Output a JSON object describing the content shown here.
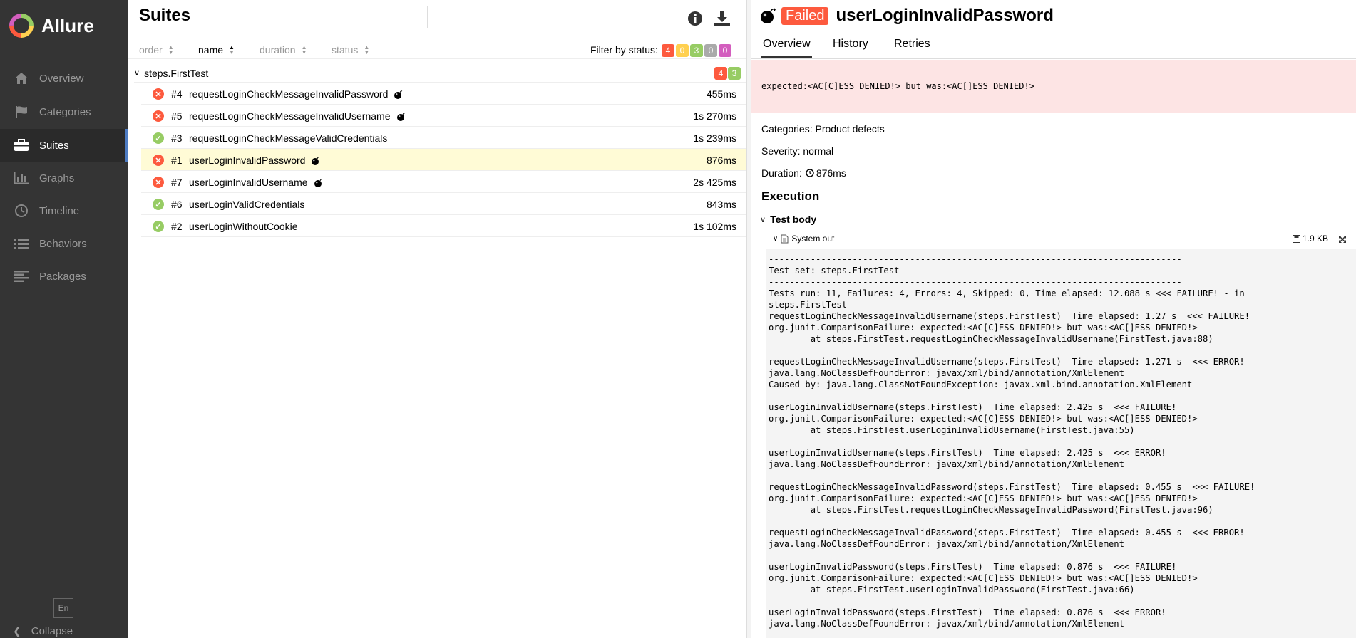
{
  "sidebar": {
    "brand": "Allure",
    "items": [
      {
        "label": "Overview",
        "icon": "home-icon"
      },
      {
        "label": "Categories",
        "icon": "flag-icon"
      },
      {
        "label": "Suites",
        "icon": "briefcase-icon"
      },
      {
        "label": "Graphs",
        "icon": "bar-chart-icon"
      },
      {
        "label": "Timeline",
        "icon": "clock-icon"
      },
      {
        "label": "Behaviors",
        "icon": "list-icon"
      },
      {
        "label": "Packages",
        "icon": "align-left-icon"
      }
    ],
    "active": "Suites",
    "language": "En",
    "collapse_label": "Collapse"
  },
  "suites": {
    "title": "Suites",
    "search_value": "",
    "sort": {
      "order": "order",
      "name": "name",
      "duration": "duration",
      "status": "status",
      "active": "name"
    },
    "filter_label": "Filter by status:",
    "filter_counts": [
      {
        "value": "4",
        "color": "#fd5a3e"
      },
      {
        "value": "0",
        "color": "#ffd050"
      },
      {
        "value": "3",
        "color": "#97cc64"
      },
      {
        "value": "0",
        "color": "#aaaaaa"
      },
      {
        "value": "0",
        "color": "#d35ebe"
      }
    ],
    "group": {
      "name": "steps.FirstTest",
      "failed": "4",
      "passed": "3"
    },
    "rows": [
      {
        "num": "#4",
        "name": "requestLoginCheckMessageInvalidPassword",
        "duration": "455ms",
        "status": "failed",
        "bomb": true
      },
      {
        "num": "#5",
        "name": "requestLoginCheckMessageInvalidUsername",
        "duration": "1s 270ms",
        "status": "failed",
        "bomb": true
      },
      {
        "num": "#3",
        "name": "requestLoginCheckMessageValidCredentials",
        "duration": "1s 239ms",
        "status": "passed",
        "bomb": false
      },
      {
        "num": "#1",
        "name": "userLoginInvalidPassword",
        "duration": "876ms",
        "status": "failed",
        "bomb": true,
        "selected": true
      },
      {
        "num": "#7",
        "name": "userLoginInvalidUsername",
        "duration": "2s 425ms",
        "status": "failed",
        "bomb": true
      },
      {
        "num": "#6",
        "name": "userLoginValidCredentials",
        "duration": "843ms",
        "status": "passed",
        "bomb": false
      },
      {
        "num": "#2",
        "name": "userLoginWithoutCookie",
        "duration": "1s 102ms",
        "status": "passed",
        "bomb": false
      }
    ],
    "status_colors": {
      "failed": "#fd5a3e",
      "passed": "#97cc64"
    }
  },
  "detail": {
    "status": "Failed",
    "test_name": "userLoginInvalidPassword",
    "tabs": [
      "Overview",
      "History",
      "Retries"
    ],
    "active_tab": "Overview",
    "error_message": "expected:<AC[C]ESS DENIED!> but was:<AC[]ESS DENIED!>",
    "categories_label": "Categories:",
    "categories_value": "Product defects",
    "severity_label": "Severity:",
    "severity_value": "normal",
    "duration_label": "Duration:",
    "duration_value": "876ms",
    "execution_title": "Execution",
    "test_body_label": "Test body",
    "system_out_label": "System out",
    "attachment_size": "1.9 KB",
    "log": "-------------------------------------------------------------------------------\nTest set: steps.FirstTest\n-------------------------------------------------------------------------------\nTests run: 11, Failures: 4, Errors: 4, Skipped: 0, Time elapsed: 12.088 s <<< FAILURE! - in\nsteps.FirstTest\nrequestLoginCheckMessageInvalidUsername(steps.FirstTest)  Time elapsed: 1.27 s  <<< FAILURE!\norg.junit.ComparisonFailure: expected:<AC[C]ESS DENIED!> but was:<AC[]ESS DENIED!>\n\tat steps.FirstTest.requestLoginCheckMessageInvalidUsername(FirstTest.java:88)\n\nrequestLoginCheckMessageInvalidUsername(steps.FirstTest)  Time elapsed: 1.271 s  <<< ERROR!\njava.lang.NoClassDefFoundError: javax/xml/bind/annotation/XmlElement\nCaused by: java.lang.ClassNotFoundException: javax.xml.bind.annotation.XmlElement\n\nuserLoginInvalidUsername(steps.FirstTest)  Time elapsed: 2.425 s  <<< FAILURE!\norg.junit.ComparisonFailure: expected:<AC[C]ESS DENIED!> but was:<AC[]ESS DENIED!>\n\tat steps.FirstTest.userLoginInvalidUsername(FirstTest.java:55)\n\nuserLoginInvalidUsername(steps.FirstTest)  Time elapsed: 2.425 s  <<< ERROR!\njava.lang.NoClassDefFoundError: javax/xml/bind/annotation/XmlElement\n\nrequestLoginCheckMessageInvalidPassword(steps.FirstTest)  Time elapsed: 0.455 s  <<< FAILURE!\norg.junit.ComparisonFailure: expected:<AC[C]ESS DENIED!> but was:<AC[]ESS DENIED!>\n\tat steps.FirstTest.requestLoginCheckMessageInvalidPassword(FirstTest.java:96)\n\nrequestLoginCheckMessageInvalidPassword(steps.FirstTest)  Time elapsed: 0.455 s  <<< ERROR!\njava.lang.NoClassDefFoundError: javax/xml/bind/annotation/XmlElement\n\nuserLoginInvalidPassword(steps.FirstTest)  Time elapsed: 0.876 s  <<< FAILURE!\norg.junit.ComparisonFailure: expected:<AC[C]ESS DENIED!> but was:<AC[]ESS DENIED!>\n\tat steps.FirstTest.userLoginInvalidPassword(FirstTest.java:66)\n\nuserLoginInvalidPassword(steps.FirstTest)  Time elapsed: 0.876 s  <<< ERROR!\njava.lang.NoClassDefFoundError: javax/xml/bind/annotation/XmlElement"
  }
}
